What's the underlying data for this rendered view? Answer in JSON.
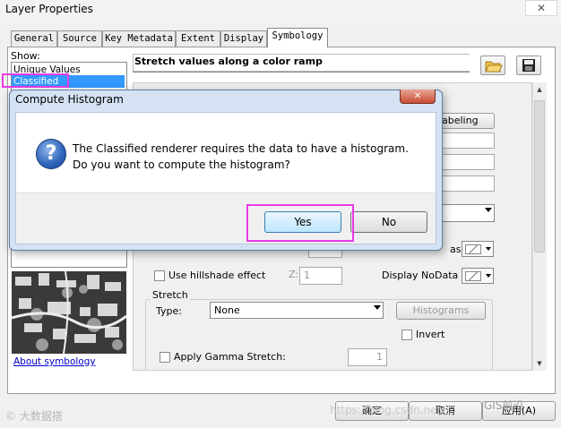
{
  "window": {
    "title": "Layer Properties",
    "close_label": "✕"
  },
  "tabs": [
    "General",
    "Source",
    "Key Metadata",
    "Extent",
    "Display",
    "Symbology"
  ],
  "show": {
    "label": "Show:",
    "items": [
      "Unique Values",
      "Classified"
    ],
    "selected": "Classified"
  },
  "panel": {
    "header": "Stretch values along a color ramp",
    "labeling_button": "abeling",
    "hillshade_label": "Use hillshade effect",
    "z_label": "Z:",
    "z_value": "1",
    "display_nodata_label": "Display NoData as",
    "as_label": "as",
    "stretch": {
      "group_title": "Stretch",
      "type_label": "Type:",
      "type_value": "None",
      "histograms_button": "Histograms",
      "invert_label": "Invert",
      "gamma_label": "Apply Gamma Stretch:",
      "gamma_value": "1"
    }
  },
  "about_link": "About symbology",
  "bottom": {
    "ok": "确定",
    "cancel": "取消",
    "apply": "应用(A)"
  },
  "watermarks": {
    "left": "© 大数据搭",
    "url": "https://blog.csdn.net/...",
    "right": "GIS前沿"
  },
  "dialog": {
    "title": "Compute Histogram",
    "close_label": "✕",
    "message_line1": "The Classified renderer requires the data to have a histogram.",
    "message_line2": "Do you want to compute the histogram?",
    "yes": "Yes",
    "no": "No"
  },
  "colors": {
    "highlight": "#ea3ae8",
    "selection": "#3399ff",
    "dialog_frame": "#d4e2f3"
  }
}
